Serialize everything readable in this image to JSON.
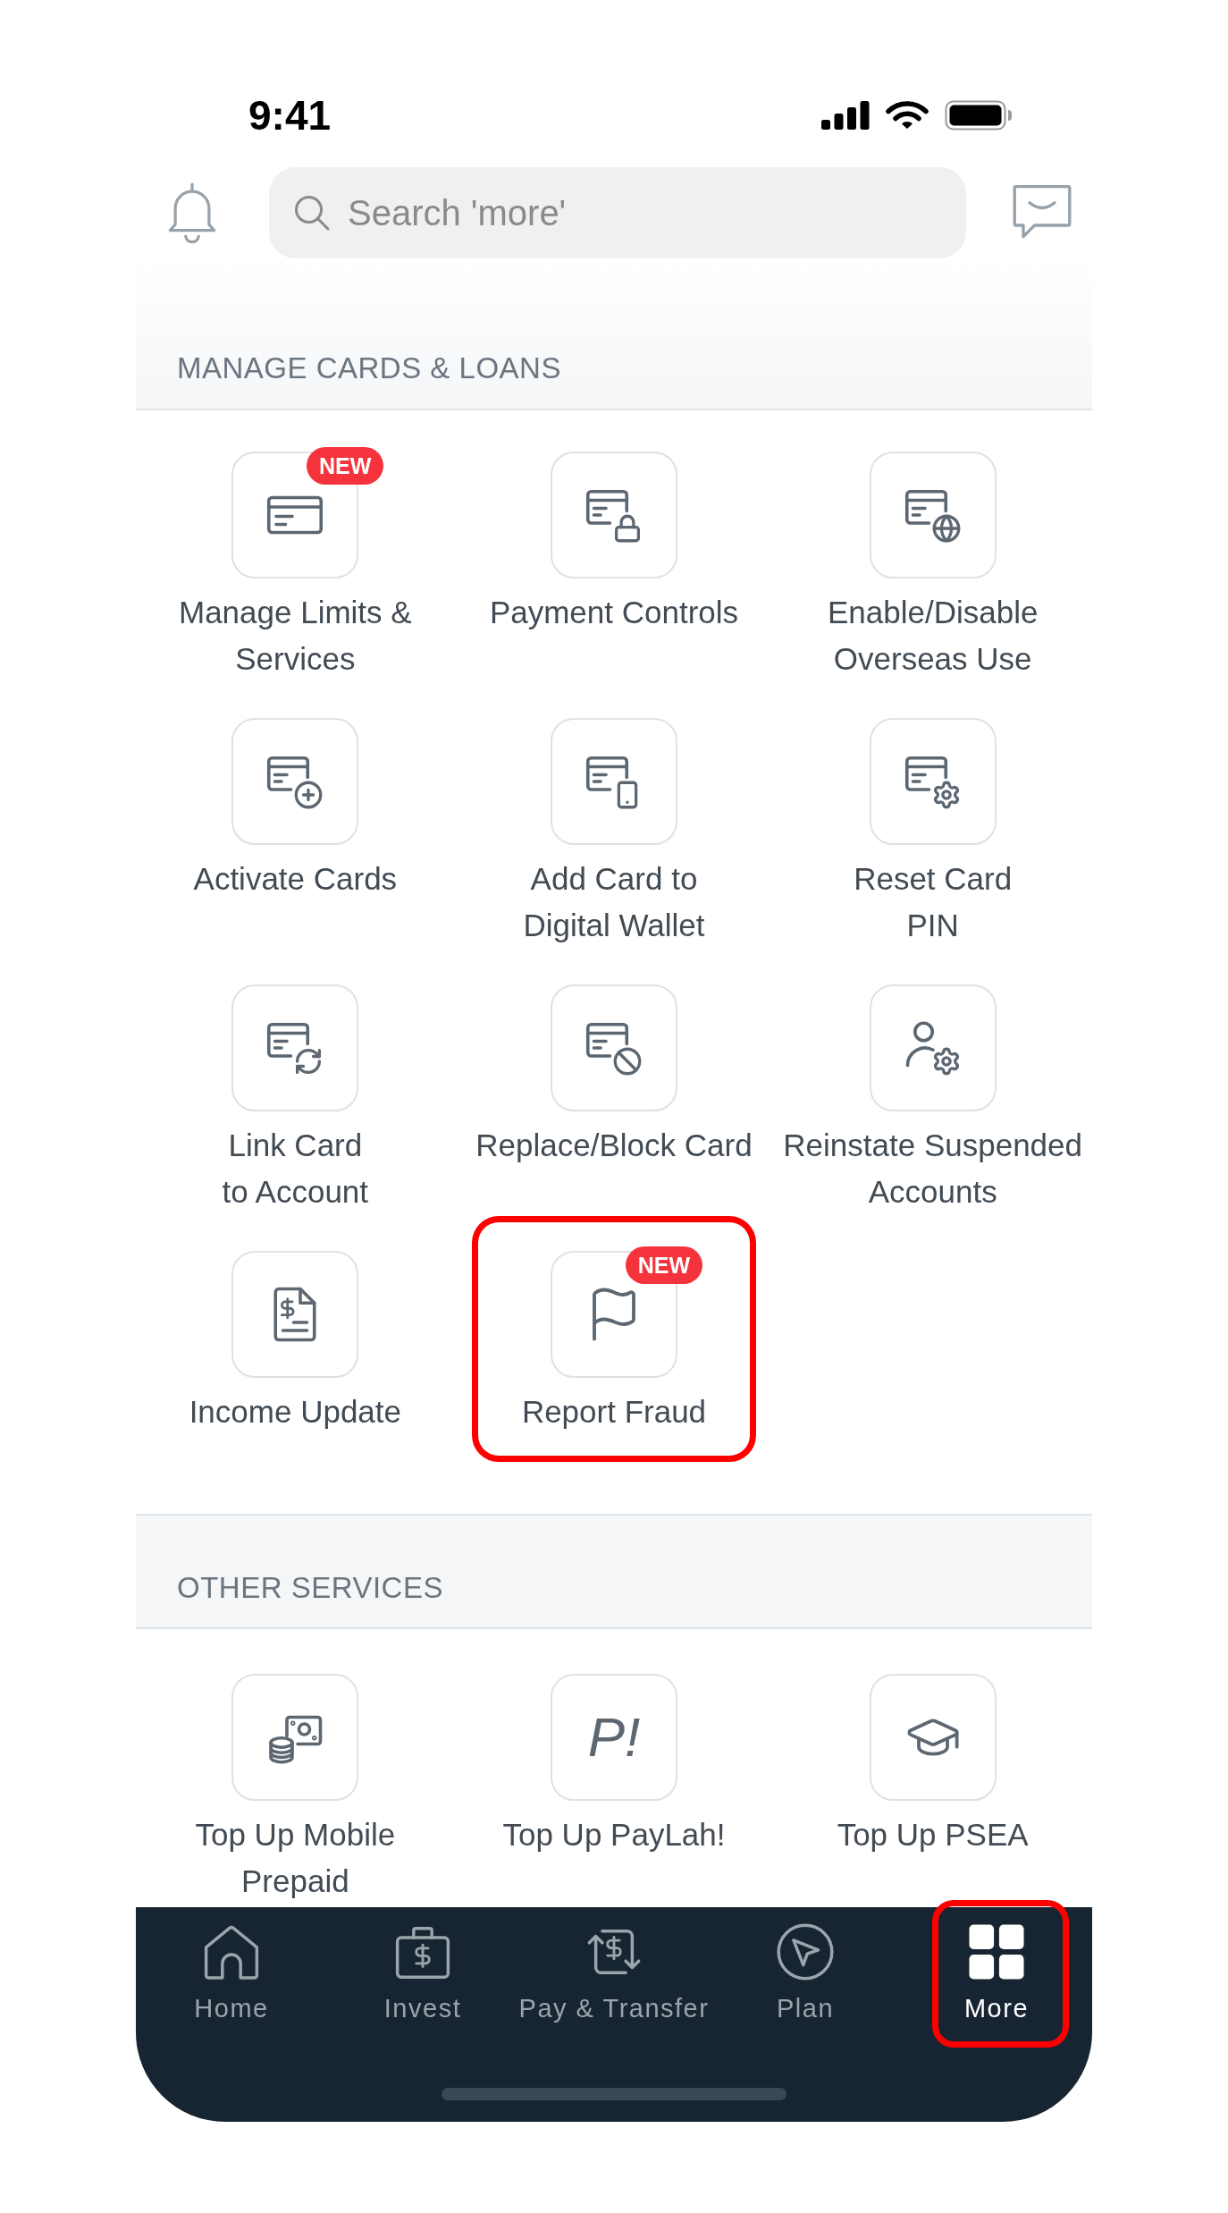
{
  "status_bar": {
    "time": "9:41"
  },
  "search": {
    "placeholder": "Search 'more'"
  },
  "sections": [
    {
      "title": "MANAGE CARDS & LOANS",
      "items": [
        {
          "label": "Manage Limits &\nServices",
          "badge": "NEW",
          "highlighted": false
        },
        {
          "label": "Payment Controls",
          "highlighted": false
        },
        {
          "label": "Enable/Disable\nOverseas Use",
          "highlighted": false
        },
        {
          "label": "Activate Cards",
          "highlighted": false
        },
        {
          "label": "Add Card to\nDigital Wallet",
          "highlighted": false
        },
        {
          "label": "Reset Card\nPIN",
          "highlighted": false
        },
        {
          "label": "Link Card\nto Account",
          "highlighted": false
        },
        {
          "label": "Replace/Block Card",
          "highlighted": false
        },
        {
          "label": "Reinstate Suspended\nAccounts",
          "highlighted": false
        },
        {
          "label": "Income Update",
          "highlighted": false
        },
        {
          "label": "Report Fraud",
          "badge": "NEW",
          "highlighted": true
        }
      ]
    },
    {
      "title": "OTHER SERVICES",
      "items": [
        {
          "label": "Top Up Mobile\nPrepaid",
          "highlighted": false
        },
        {
          "label": "Top Up PayLah!",
          "icon_text": "P!",
          "highlighted": false
        },
        {
          "label": "Top Up PSEA",
          "highlighted": false
        }
      ]
    }
  ],
  "tabs": [
    {
      "label": "Home",
      "selected": false,
      "highlighted": false
    },
    {
      "label": "Invest",
      "selected": false,
      "highlighted": false
    },
    {
      "label": "Pay & Transfer",
      "selected": false,
      "highlighted": false
    },
    {
      "label": "Plan",
      "selected": false,
      "highlighted": false
    },
    {
      "label": "More",
      "selected": true,
      "highlighted": true
    }
  ]
}
